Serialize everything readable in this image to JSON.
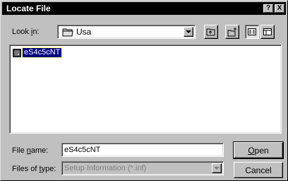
{
  "window": {
    "title": "Locate File",
    "help_label": "?",
    "close_label": "X"
  },
  "look_in": {
    "label_prefix": "Look ",
    "label_accel": "i",
    "label_suffix": "n:",
    "value": "Usa"
  },
  "files": [
    {
      "name": "eS4c5cNT",
      "selected": true,
      "icon": "setup-file-icon"
    }
  ],
  "file_name": {
    "label_prefix": "File ",
    "label_accel": "n",
    "label_suffix": "ame:",
    "value": "eS4c5cNT"
  },
  "file_type": {
    "label_prefix": "Files of ",
    "label_accel": "t",
    "label_suffix": "ype:",
    "value": "Setup Information (*.inf)"
  },
  "buttons": {
    "open_accel": "O",
    "open_rest": "pen",
    "cancel": "Cancel"
  }
}
